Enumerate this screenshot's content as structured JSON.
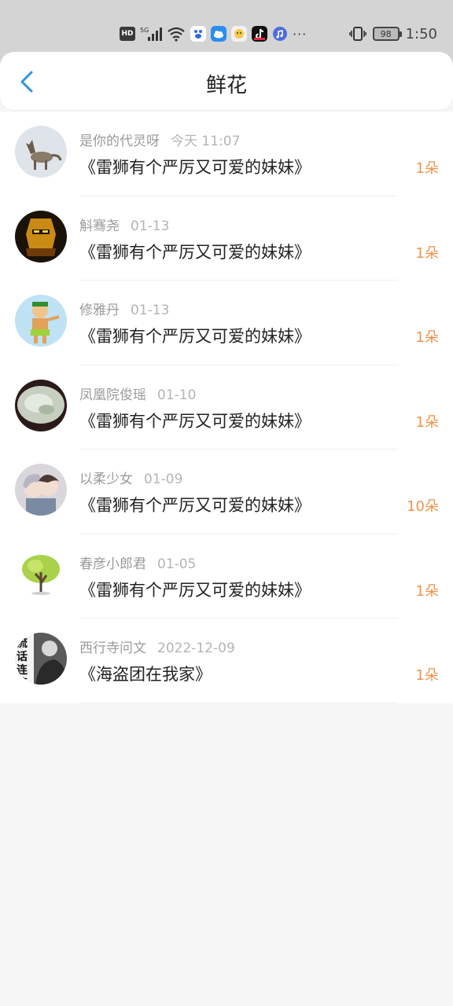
{
  "status_bar": {
    "hd": "HD",
    "network": "5G",
    "battery": "98",
    "time": "1:50",
    "more": "···"
  },
  "header": {
    "title": "鲜花"
  },
  "items": [
    {
      "user": "是你的代灵呀",
      "date": "今天 11:07",
      "book": "《雷狮有个严厉又可爱的妹妹》",
      "count": "1朵"
    },
    {
      "user": "斛骞尧",
      "date": "01-13",
      "book": "《雷狮有个严厉又可爱的妹妹》",
      "count": "1朵"
    },
    {
      "user": "修雅丹",
      "date": "01-13",
      "book": "《雷狮有个严厉又可爱的妹妹》",
      "count": "1朵"
    },
    {
      "user": "凤凰院俊瑶",
      "date": "01-10",
      "book": "《雷狮有个严厉又可爱的妹妹》",
      "count": "1朵"
    },
    {
      "user": "以柔少女",
      "date": "01-09",
      "book": "《雷狮有个严厉又可爱的妹妹》",
      "count": "10朵"
    },
    {
      "user": "春彦小郎君",
      "date": "01-05",
      "book": "《雷狮有个严厉又可爱的妹妹》",
      "count": "1朵"
    },
    {
      "user": "西行寺问文",
      "date": "2022-12-09",
      "book": "《海盗团在我家》",
      "count": "1朵"
    }
  ],
  "avatar_text": "流话连篇",
  "colors": {
    "accent": "#2f93e6",
    "count": "#f0924a",
    "meta": "#9a9a9a"
  }
}
